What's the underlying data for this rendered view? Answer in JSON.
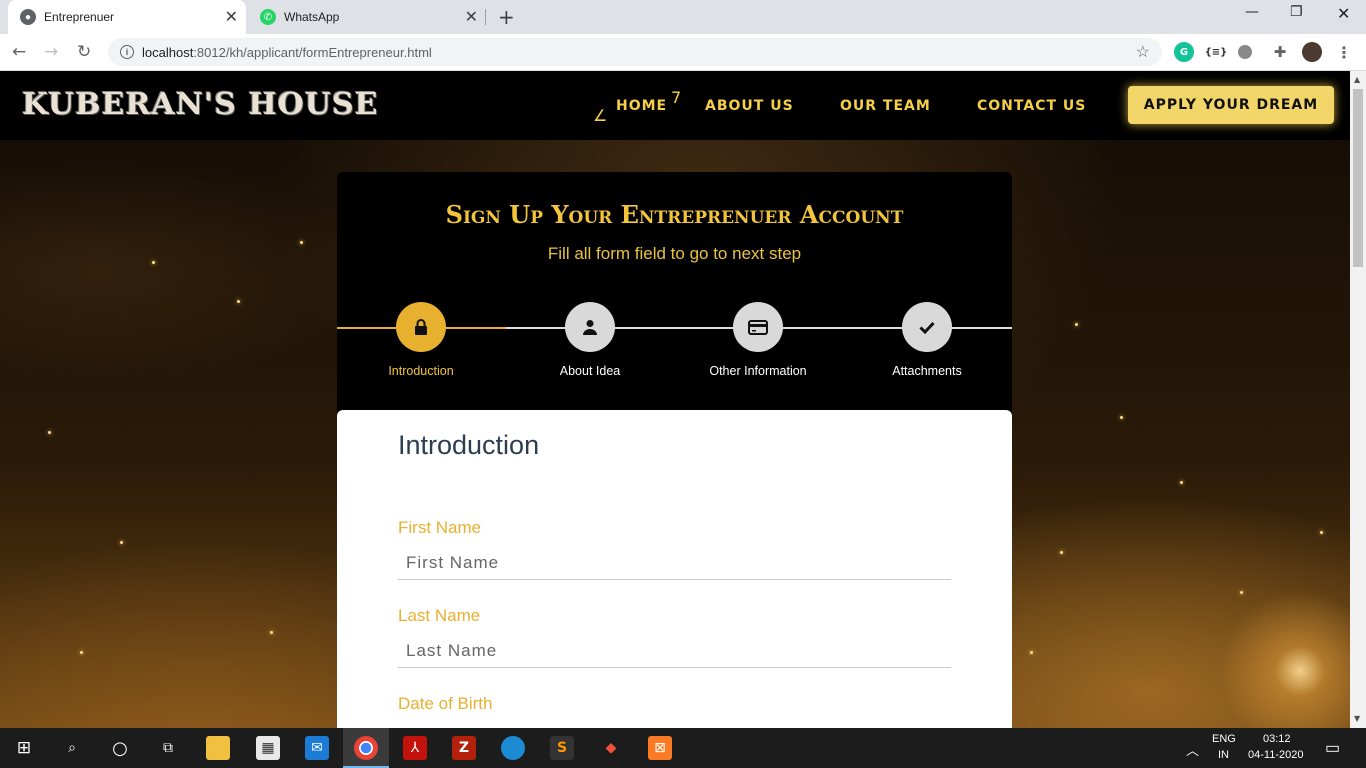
{
  "browser": {
    "tabs": [
      {
        "title": "Entreprenuer",
        "active": true
      },
      {
        "title": "WhatsApp",
        "active": false
      }
    ],
    "url_host": "localhost",
    "url_path": ":8012/kh/applicant/formEntrepreneur.html"
  },
  "site": {
    "logo": "KUBERAN'S HOUSE",
    "nav": [
      "HOME",
      "ABOUT US",
      "OUR TEAM",
      "CONTACT US"
    ],
    "cta": "APPLY YOUR DREAM",
    "accent_color": "#f5cf48"
  },
  "form": {
    "title": "Sign Up Your Entreprenuer Account",
    "subtitle": "Fill all form field to go to next step",
    "steps": [
      {
        "label": "Introduction",
        "icon": "lock-icon",
        "active": true
      },
      {
        "label": "About Idea",
        "icon": "user-icon",
        "active": false
      },
      {
        "label": "Other Information",
        "icon": "credit-card-icon",
        "active": false
      },
      {
        "label": "Attachments",
        "icon": "check-icon",
        "active": false
      }
    ],
    "section_title": "Introduction",
    "fields": [
      {
        "label": "First Name",
        "placeholder": "First Name"
      },
      {
        "label": "Last Name",
        "placeholder": "Last Name"
      },
      {
        "label": "Date of Birth"
      }
    ]
  },
  "taskbar": {
    "language": "ENG",
    "region": "IN",
    "time": "03:12",
    "date": "04-11-2020"
  }
}
